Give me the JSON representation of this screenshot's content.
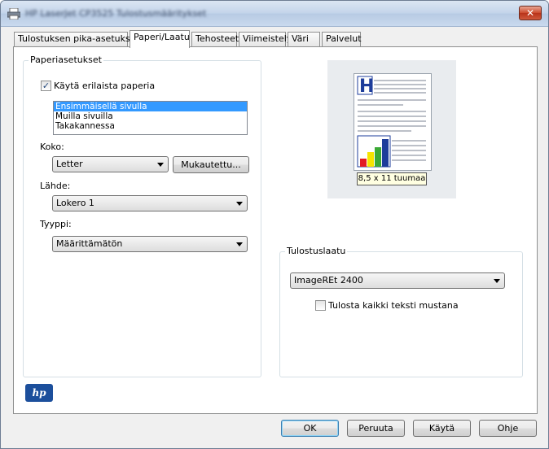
{
  "window": {
    "title": "HP LaserJet CP3525 Tulostusmääritykset",
    "close_glyph": "✕"
  },
  "tabs": [
    {
      "label": "Tulostuksen pika-asetukset"
    },
    {
      "label": "Paperi/Laatu"
    },
    {
      "label": "Tehosteet"
    },
    {
      "label": "Viimeistely"
    },
    {
      "label": "Väri"
    },
    {
      "label": "Palvelut"
    }
  ],
  "active_tab": "Paperi/Laatu",
  "paper": {
    "group_label": "Paperiasetukset",
    "use_different_paper_label": "Käytä erilaista paperia",
    "use_different_paper_checked": true,
    "pages_list": [
      "Ensimmäisellä sivulla",
      "Muilla sivuilla",
      "Takakannessa"
    ],
    "pages_selected": "Ensimmäisellä sivulla",
    "size_label": "Koko:",
    "size_value": "Letter",
    "custom_button": "Mukautettu...",
    "source_label": "Lähde:",
    "source_value": "Lokero 1",
    "type_label": "Tyyppi:",
    "type_value": "Määrittämätön"
  },
  "preview": {
    "size_text": "8,5 x 11 tuumaa",
    "bar_colors": [
      "#e31b23",
      "#f5e400",
      "#3aa935",
      "#1e3d9b"
    ]
  },
  "quality": {
    "group_label": "Tulostuslaatu",
    "value": "ImageREt 2400",
    "black_text_label": "Tulosta kaikki teksti mustana",
    "black_text_checked": false
  },
  "brand": {
    "logo_text": "hp"
  },
  "buttons": {
    "ok": "OK",
    "cancel": "Peruuta",
    "apply": "Käytä",
    "help": "Ohje"
  },
  "icons": {
    "title": "printer-icon",
    "combo_arrow": "chevron-down-icon"
  }
}
